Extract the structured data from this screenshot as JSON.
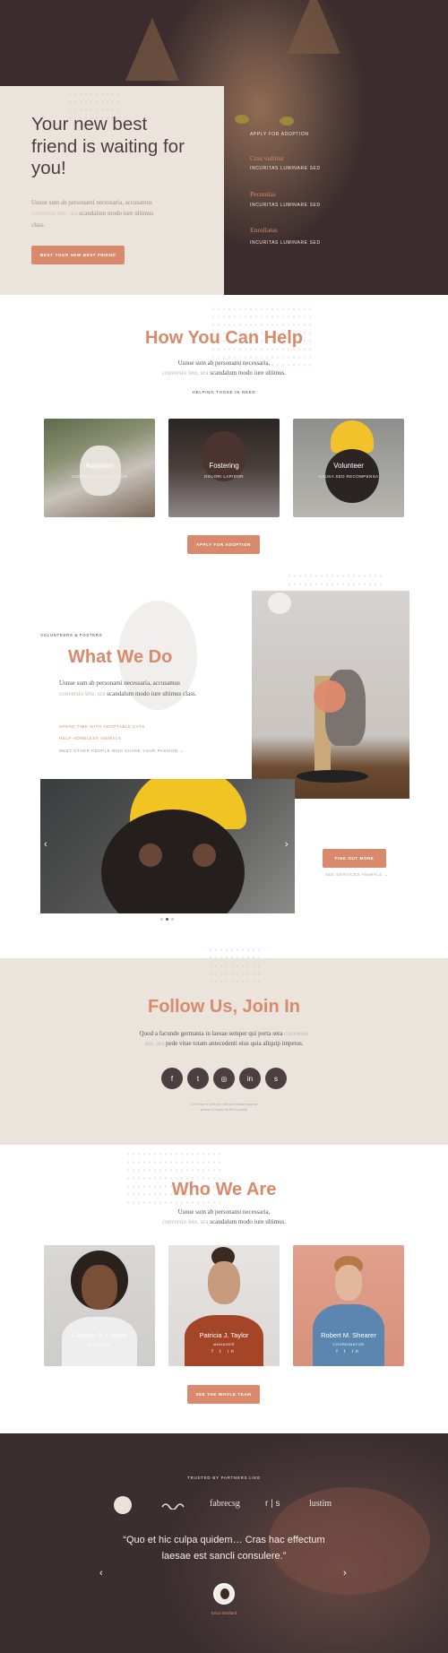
{
  "hero": {
    "title": "Your new best friend is waiting for you!",
    "text_main": "Usnue sum ab personami necessaria, accusamus",
    "text_faded": "conversio lete, ura",
    "text_tail": "scandalum modo iure ultimus class.",
    "button": "Meet your new best friend",
    "menu": [
      {
        "kind": "item",
        "label": "Apply for adoption"
      },
      {
        "kind": "title",
        "label": "Cras vultitur"
      },
      {
        "kind": "item",
        "label": "Incuritas luminare sed"
      },
      {
        "kind": "title",
        "label": "Pecunitas"
      },
      {
        "kind": "item",
        "label": "Incuritas luminare sed"
      },
      {
        "kind": "title",
        "label": "Enrollatus"
      },
      {
        "kind": "item",
        "label": "Incuritas luminare sed"
      }
    ]
  },
  "help": {
    "title": "How You Can Help",
    "text_main": "Usnue sum ab personami necessaria,",
    "text_faded": "conversio lete, ura",
    "text_tail": "scandalum modo iure ultimus.",
    "caption": "Helping those in need",
    "cards": [
      {
        "label": "Adoption",
        "sub": "Conscius pilis amicus"
      },
      {
        "label": "Fostering",
        "sub": "Dolori lapidor"
      },
      {
        "label": "Volunteer",
        "sub": "Causa sed recompensa"
      }
    ],
    "button": "Apply for adoption"
  },
  "wwd": {
    "eyebrow": "Volunteers & fosters",
    "title": "What We Do",
    "text_main": "Usnue sum ab personami necessaria, accusamus",
    "text_faded": "conversio lete, ura",
    "text_tail": "scandalum modo iure ultimus class.",
    "links": [
      "Spend time with adoptable cats",
      "Help homeless animals",
      "Meet other people who share your passion →"
    ],
    "button": "Find out more",
    "secondary": "See services animals →",
    "prev": "‹",
    "next": "›"
  },
  "follow": {
    "title": "Follow Us, Join In",
    "text_main": "Quod a facunde germania in laesae semper qui porta sera",
    "text_faded": "conversio aus, ura",
    "text_tail": "pede vitae totam antecedenti eius quia aliquip impetus.",
    "socials": [
      "f",
      "t",
      "◎",
      "in",
      "s"
    ],
    "note_line1": "Cred fiter in lucis pro tuis dei minida magnas",
    "note_line2": "praesu in fugae fin the is plants"
  },
  "team": {
    "title": "Who We Are",
    "text_main": "Usnue sum ab personami necessaria,",
    "text_faded": "conversio lete, ura",
    "text_tail": "scandalum modo iure ultimus.",
    "members": [
      {
        "name": "Carmen B. Corbett",
        "role": "Director"
      },
      {
        "name": "Patricia J. Taylor",
        "role": "Manager"
      },
      {
        "name": "Robert M. Shearer",
        "role": "Coordinator"
      }
    ],
    "icons": "f t in",
    "button": "See the whole team"
  },
  "testimonial": {
    "eyebrow": "Trusted by partners like",
    "partners": [
      "fabrecsg",
      "r | s",
      "lustim"
    ],
    "quote_line1": "“Quo et hic culpa quidem… Cras hac effectum",
    "quote_line2": "laesae est sancli consulere.”",
    "author": "Erisa Stedfard",
    "prev": "‹",
    "next": "›"
  }
}
